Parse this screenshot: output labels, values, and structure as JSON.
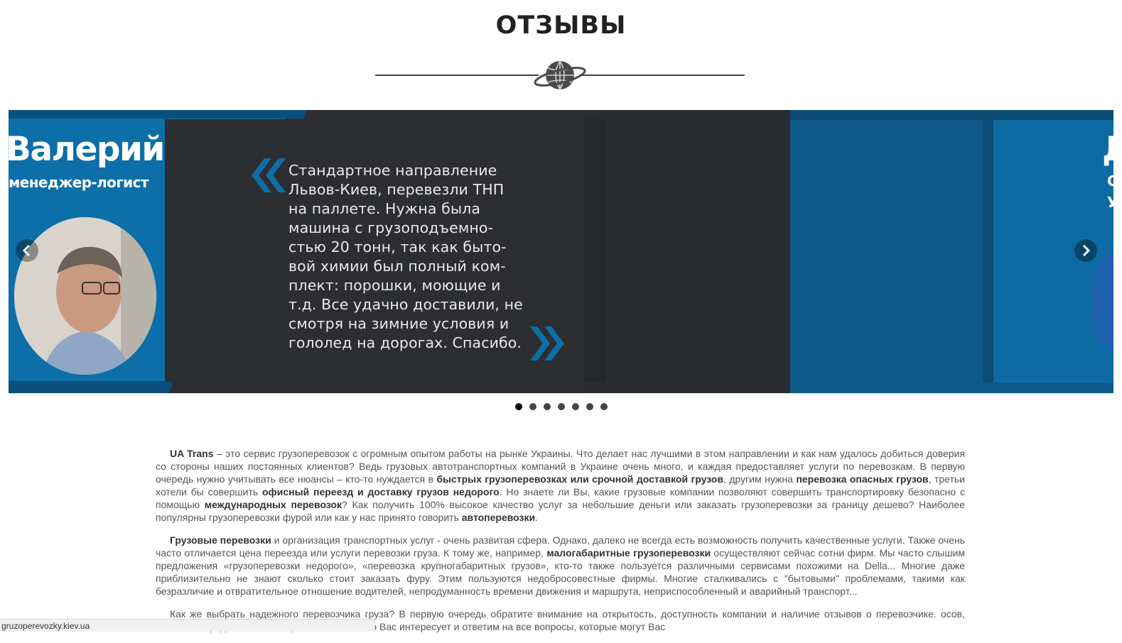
{
  "section": {
    "title": "ОТЗЫВЫ"
  },
  "slider": {
    "current_slide": {
      "name": "Валерий",
      "role": "менеджер-логист",
      "quote": "Стандартное направление\nЛьвов-Киев, перевезли ТНП\nна паллете. Нужна была\nмашина с грузоподъемно-\nстью 20 тонн, так как быто-\nвой химии был полный ком-\nплект: порошки, моющие и\nт.д. Все удачно доставили, не\nсмотря на зимние условия и\nгололед на дорогах. Спасибо."
    },
    "next_slide": {
      "name_initial": "Д",
      "line1": "С",
      "line2": "У"
    },
    "dots_count": 7,
    "active_dot": 1,
    "colors": {
      "accent": "#0d6fa8",
      "dark": "#2b2d30",
      "next_bg": "#0d5a8a"
    }
  },
  "article": {
    "p1": {
      "s1": "UA Trans",
      "t1": " – это сервис грузоперевозок с огромным опытом работы на рынке Украины. Что делает нас лучшими в этом направлении и как нам удалось добиться доверия со стороны наших постоянных клиентов? Ведь грузовых автотранспортных компаний в Украине очень много, и каждая предоставляет услуги по перевозкам. В первую очередь нужно учитывать все нюансы – кто-то нуждается в ",
      "s2": "быстрых грузоперевозках или срочной доставкой грузов",
      "t2": ", другим нужна ",
      "s3": "перевозка опасных грузов",
      "t3": ", третьи хотели бы совершить ",
      "s4": "офисный переезд и доставку грузов недорого",
      "t4": ". Но знаете ли Вы, какие грузовые компании позволяют совершить транспортировку безопасно с помощью ",
      "s5": "международных перевозок",
      "t5": "? Как получить 100% высокое качество услуг за небольшие деньги или заказать грузоперевозки за границу дешево? Наиболее популярны грузоперевозки фурой или как у нас принято говорить ",
      "s6": "автоперевозки",
      "t6": "."
    },
    "p2": {
      "s1": "Грузовые перевозки",
      "t1": " и организация транспортных услуг - очень развитая сфера. Однако, далеко не всегда есть возможность получить качественные услуги. Также очень часто отличается цена переезда или услуги перевозки груза. К тому же, например, ",
      "s2": "малогабаритные грузоперевозки",
      "t2": " осуществляют сейчас сотни фирм. Мы часто слышим предложения «грузоперевозки недорого», «перевозка крупногабаритных грузов», кто-то также пользуется различными сервисами похожими на Della... Многие даже приблизительно не знают сколько стоит заказать фуру. Этим пользуются недобросовестные фирмы. Многие сталкивались с \"бытовыми\" проблемами, такими как безразличие и отвратительное отношение водителей, непродуманность времени движения и маршрута, неприспособленный и аварийный транспорт..."
    },
    "p3": {
      "t1": "Как же выбрать надежного перевозчика груза? В первую очередь обратите внимание на открытость, доступность компании и наличие отзывов о перевозчике. ",
      "t2": "осов, отзывов и предложений. Мы расскажем все что Вас интересует и ответим на все вопросы, которые могут Вас"
    }
  },
  "status_bar": {
    "url": "gruzoperevozky.kiev.ua"
  }
}
